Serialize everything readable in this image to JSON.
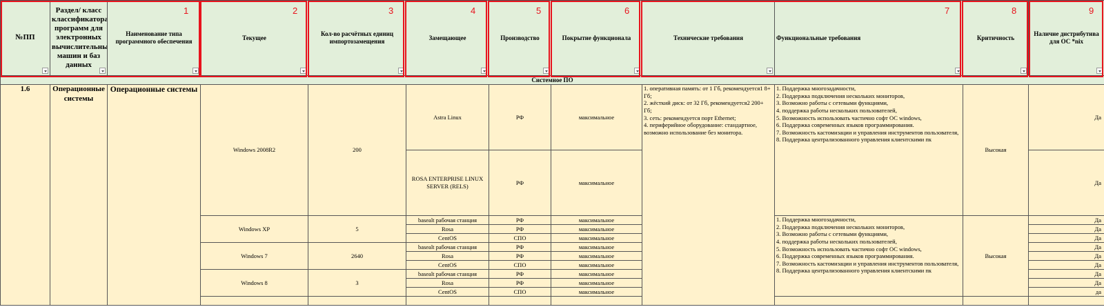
{
  "headers": {
    "npp": "№ПП",
    "section": "Раздел/ класс классификатора программ для электронных вычислительных машин и баз данных",
    "type_name": "Наименование типа программного обеспечения",
    "current": "Текущее",
    "units": "Кол-во расчётных единиц импортозамещения",
    "replacement": "Замещающее",
    "production": "Производство",
    "coverage": "Покрытие функционала",
    "tech_req": "Технические требования",
    "func_req": "Функциональные требования",
    "criticality": "Критичность",
    "distro": "Наличие дистрибутива для ОС *nix"
  },
  "markers": [
    "1",
    "2",
    "3",
    "4",
    "5",
    "6",
    "7",
    "8",
    "9"
  ],
  "section_title": "Системное ПО",
  "row": {
    "npp": "1.6",
    "section": "Операционные системы",
    "type_name": "Операционные системы"
  },
  "groups": [
    {
      "current": "Windows 2008R2",
      "units": "200"
    },
    {
      "current": "Windows XP",
      "units": "5"
    },
    {
      "current": "Windows 7",
      "units": "2640"
    },
    {
      "current": "Windows 8",
      "units": "3"
    }
  ],
  "replacements": [
    {
      "name": "Astra Linux",
      "prod": "РФ",
      "cov": "максимальное",
      "distro": "Да"
    },
    {
      "name": "ROSA ENTERPRISE LINUX SERVER (RELS)",
      "prod": "РФ",
      "cov": "максимальное",
      "distro": "Да"
    },
    {
      "name": "basealt рабочая станция",
      "prod": "РФ",
      "cov": "максимальное",
      "distro": "Да"
    },
    {
      "name": "Rosa",
      "prod": "РФ",
      "cov": "максимальное",
      "distro": "Да"
    },
    {
      "name": "CentOS",
      "prod": "СПО",
      "cov": "максимальное",
      "distro": "Да"
    },
    {
      "name": "basealt рабочая станция",
      "prod": "РФ",
      "cov": "максимальное",
      "distro": "Да"
    },
    {
      "name": "Rosa",
      "prod": "РФ",
      "cov": "максимальное",
      "distro": "Да"
    },
    {
      "name": "CentOS",
      "prod": "СПО",
      "cov": "максимальное",
      "distro": "Да"
    },
    {
      "name": "basealt рабочая станция",
      "prod": "РФ",
      "cov": "максимальное",
      "distro": "Да"
    },
    {
      "name": "Rosa",
      "prod": "РФ",
      "cov": "максимальное",
      "distro": "Да"
    },
    {
      "name": "CentOS",
      "prod": "СПО",
      "cov": "максимальное",
      "distro": "да"
    }
  ],
  "tech_req": "1. оперативная память: от 1 Гб, рекомендуется1 8+ Гб;\n2. жёсткий диск: от 32 Гб, рекомендуется2 200+ Гб;\n3. сеть: рекомендуется порт Ethernet;\n4. периферийное оборудование: стандартное, возможно использование без монитора.",
  "func_req_1": "1. Поддержка многозадачности,\n2. Поддержка подключения нескольких мониторов,\n3. Возможно работы с сетевыми функциями,\n4. поддержка работы нескольких пользователей,\n5. Возможность использовать частично софт ОС windows,\n6. Поддержка современных языков программирования.\n7. Возможность кастомизации и управления инструментов пользователя,\n8. Поддержка централизованного управления клиентскими пк",
  "func_req_2": "1. Поддержка многозадачности,\n2. Поддержка подключения нескольких мониторов,\n3. Возможно работы с сетевыми функциями,\n4. поддержка работы нескольких пользователей,\n5. Возможность использовать частично софт ОС windows,\n6. Поддержка современных языков программирования.\n7. Возможность кастомизации и управления инструментов пользователя,\n8. Поддержка централизованного управления клиентскими пк",
  "criticality_1": "Высокая",
  "criticality_2": "Высокая",
  "colors": {
    "header_bg": "#e2efda",
    "body_bg": "#fff2cc",
    "marker": "#e8131d"
  }
}
